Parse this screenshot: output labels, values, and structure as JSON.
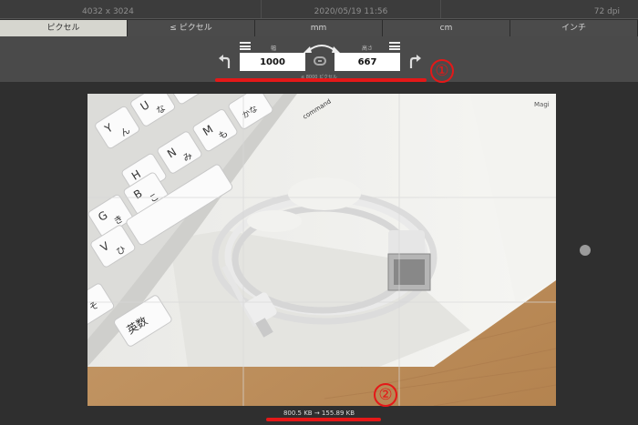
{
  "info": {
    "dimensions": "4032 x 3024",
    "date": "2020/05/19 11:56",
    "dpi": "72 dpi"
  },
  "tabs": [
    {
      "label": "ピクセル",
      "active": true
    },
    {
      "label": "≤ ピクセル",
      "active": false
    },
    {
      "label": "mm",
      "active": false
    },
    {
      "label": "cm",
      "active": false
    },
    {
      "label": "インチ",
      "active": false
    }
  ],
  "resize": {
    "width_label": "幅",
    "height_label": "高さ",
    "width_value": "1000",
    "height_value": "667",
    "max_hint": "≤ 8000 ピクセル"
  },
  "annotations": {
    "marker1": "①",
    "marker2": "②"
  },
  "footer": {
    "file_size": "800.5 KB  →  155.89 KB"
  },
  "photo": {
    "key_labels": [
      "Y",
      "ん",
      "H",
      "く",
      "N",
      "み",
      "G",
      "き",
      "B",
      "こ",
      "V",
      "ひ",
      "そ",
      "英数",
      "U",
      "な",
      "J",
      "ま",
      "M",
      "も",
      "かな",
      "command"
    ],
    "box_text": "Magi"
  },
  "colors": {
    "accent_red": "#e41818",
    "active_tab": "#d6d6cf",
    "toolbar": "#4a4a4a",
    "background": "#2f2f2f"
  }
}
